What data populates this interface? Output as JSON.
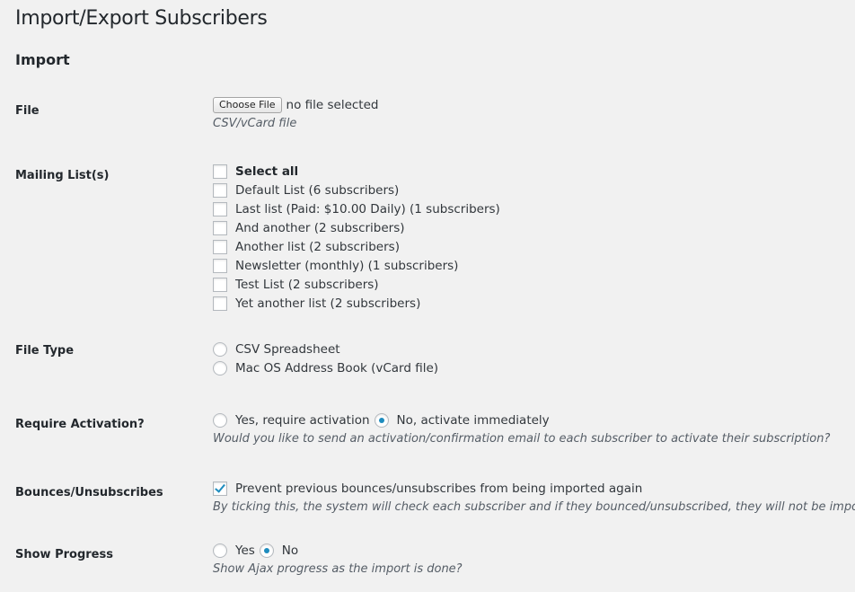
{
  "page": {
    "title": "Import/Export Subscribers",
    "section": "Import"
  },
  "colors": {
    "background": "#f1f1f1",
    "accent": "#1e8cbe",
    "text": "#23282d",
    "description": "#555d66"
  },
  "file": {
    "label": "File",
    "button_label": "Choose File",
    "status": "no file selected",
    "description": "CSV/vCard file"
  },
  "mailing_lists": {
    "label": "Mailing List(s)",
    "select_all": {
      "label": "Select all",
      "checked": false
    },
    "items": [
      {
        "label": "Default List (6 subscribers)",
        "checked": false
      },
      {
        "label": "Last list (Paid: $10.00 Daily) (1 subscribers)",
        "checked": false
      },
      {
        "label": "And another (2 subscribers)",
        "checked": false
      },
      {
        "label": "Another list (2 subscribers)",
        "checked": false
      },
      {
        "label": "Newsletter (monthly) (1 subscribers)",
        "checked": false
      },
      {
        "label": "Test List (2 subscribers)",
        "checked": false
      },
      {
        "label": "Yet another list (2 subscribers)",
        "checked": false
      }
    ]
  },
  "file_type": {
    "label": "File Type",
    "options": [
      {
        "label": "CSV Spreadsheet",
        "selected": false
      },
      {
        "label": "Mac OS Address Book (vCard file)",
        "selected": false
      }
    ]
  },
  "require_activation": {
    "label": "Require Activation?",
    "options": [
      {
        "label": "Yes, require activation",
        "selected": false
      },
      {
        "label": "No, activate immediately",
        "selected": true
      }
    ],
    "description": "Would you like to send an activation/confirmation email to each subscriber to activate their subscription?"
  },
  "bounces": {
    "label": "Bounces/Unsubscribes",
    "checkbox_label": "Prevent previous bounces/unsubscribes from being imported again",
    "checked": true,
    "description": "By ticking this, the system will check each subscriber and if they bounced/unsubscribed, they will not be imported."
  },
  "show_progress": {
    "label": "Show Progress",
    "options": [
      {
        "label": "Yes",
        "selected": false
      },
      {
        "label": "No",
        "selected": true
      }
    ],
    "description": "Show Ajax progress as the import is done?"
  }
}
